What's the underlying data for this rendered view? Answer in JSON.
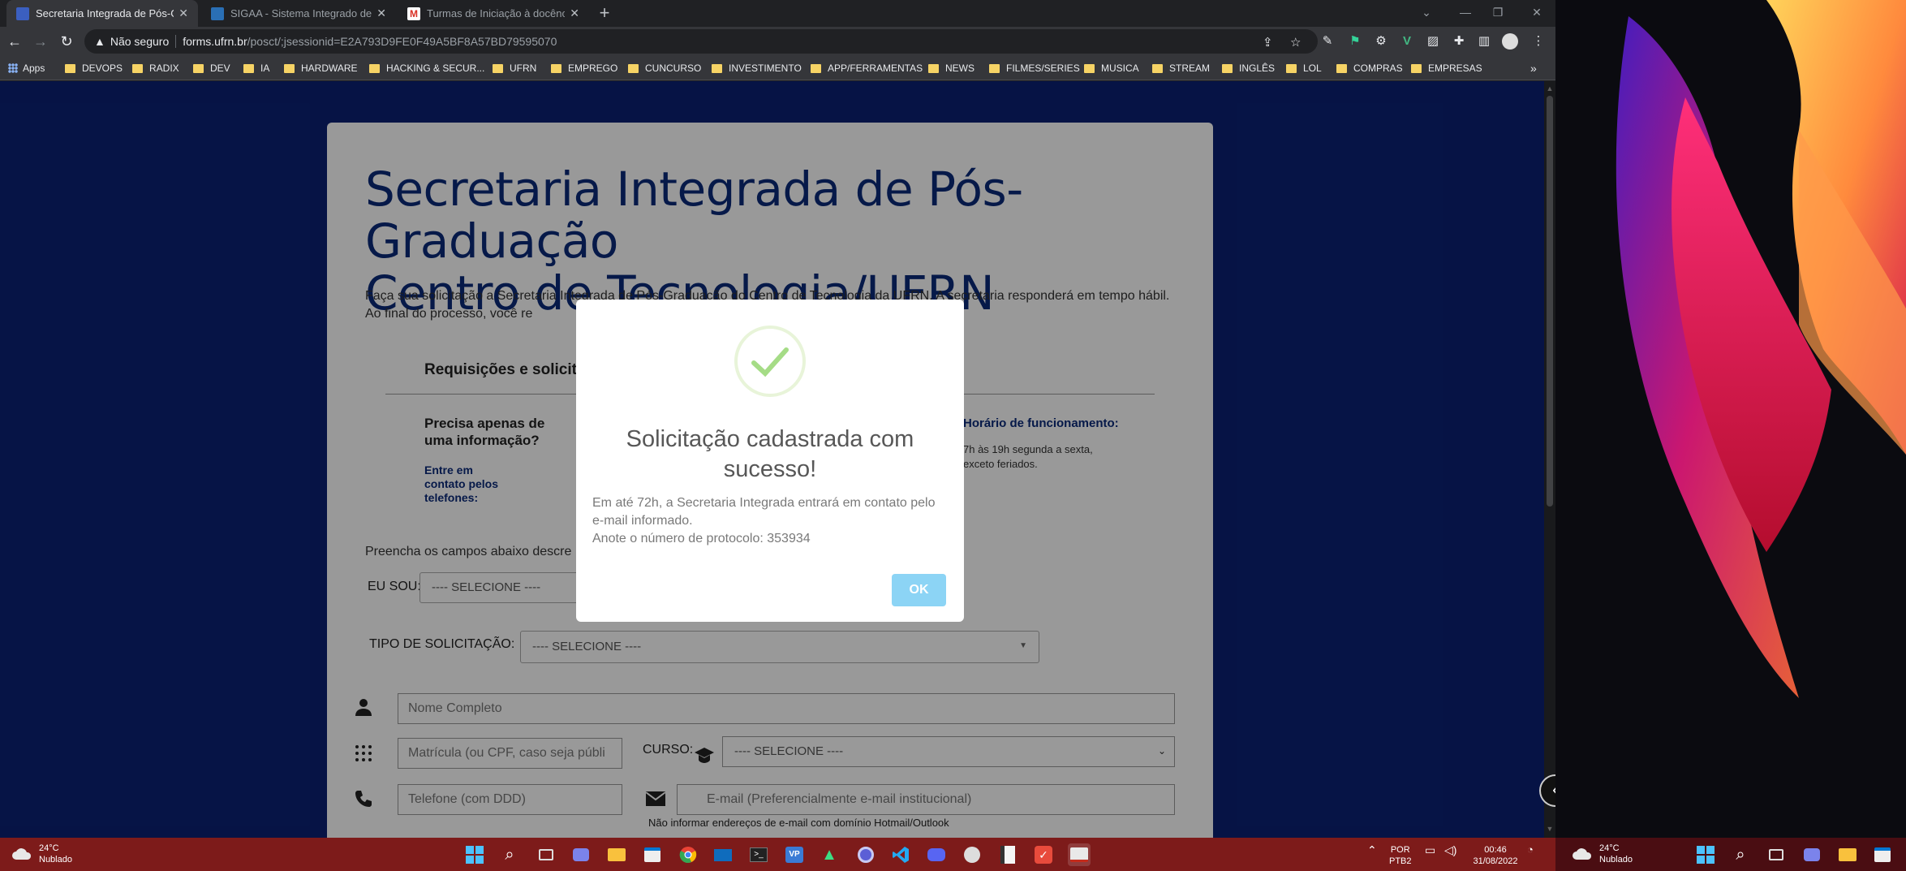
{
  "browser": {
    "tabs": [
      {
        "title": "Secretaria Integrada de Pós-Grad",
        "active": true
      },
      {
        "title": "SIGAA - Sistema Integrado de Ge",
        "active": false
      },
      {
        "title": "Turmas de Iniciação à docência",
        "active": false
      }
    ],
    "address": {
      "security_text": "Não seguro",
      "host": "forms.ufrn.br",
      "path": "/posct/;jsessionid=E2A793D9FE0F49A5BF8A57BD79595070"
    },
    "bookmarks": [
      "Apps",
      "DEVOPS",
      "RADIX",
      "DEV",
      "IA",
      "HARDWARE",
      "HACKING & SECUR...",
      "UFRN",
      "EMPREGO",
      "CUNCURSO",
      "INVESTIMENTO",
      "APP/FERRAMENTAS",
      "NEWS",
      "FILMES/SERIES",
      "MUSICA",
      "STREAM",
      "INGLÊS",
      "LOL",
      "COMPRAS",
      "EMPRESAS"
    ]
  },
  "page": {
    "title_line1": "Secretaria Integrada de Pós-Graduação",
    "title_line2": "Centro de Tecnologia/UFRN",
    "intro": "Faça sua solicitação a Secretaria Integrada de Pós-Graduação do Centro de Tecnologia da UFRN. A secretaria responderá em tempo hábil. Ao final do processo, você re",
    "requisitions_heading": "Requisições e solicit",
    "info_heading": "Precisa apenas de uma informação?",
    "contact_label": "Entre em contato pelos telefones:",
    "hours_heading": "Horário de funcionamento:",
    "hours_text": "7h às 19h segunda a sexta, exceto feriados.",
    "fill_label": "Preencha os campos abaixo descre",
    "eu_sou_label": "EU SOU:",
    "eu_sou_value": "---- SELECIONE ----",
    "tipo_label": "TIPO DE SOLICITAÇÃO:",
    "tipo_value": "---- SELECIONE ----",
    "name_placeholder": "Nome Completo",
    "matricula_placeholder": "Matrícula (ou CPF, caso seja públi",
    "curso_label": "CURSO:",
    "curso_value": "---- SELECIONE ----",
    "phone_placeholder": "Telefone (com DDD)",
    "email_placeholder": "E-mail (Preferencialmente e-mail institucional)",
    "email_note": "Não informar endereços de e-mail com domínio Hotmail/Outlook"
  },
  "modal": {
    "title": "Solicitação cadastrada com sucesso!",
    "body_line1": "Em até 72h, a Secretaria Integrada entrará em contato pelo e-mail informado.",
    "body_line2": "Anote o número de protocolo: 353934",
    "ok_label": "OK"
  },
  "taskbar": {
    "weather_temp": "24°C",
    "weather_desc": "Nublado",
    "lang_line1": "POR",
    "lang_line2": "PTB2",
    "time": "00:46",
    "date": "31/08/2022",
    "weather2_temp": "24°C",
    "weather2_desc": "Nublado"
  },
  "colors": {
    "page_bg": "#0a2174",
    "title_blue": "#0b2a7a",
    "success_green": "#a5dc86",
    "ok_button": "#8cd4f5",
    "taskbar_bg": "#7d1b1a"
  }
}
